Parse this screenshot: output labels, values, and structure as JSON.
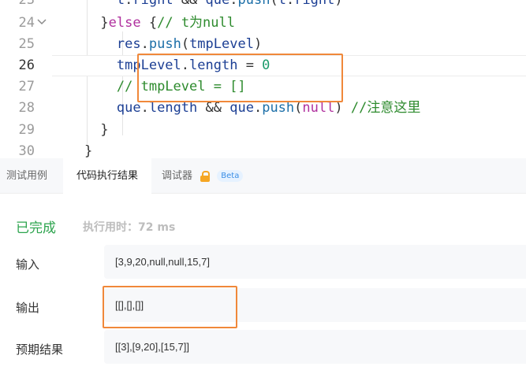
{
  "editor": {
    "lines": [
      {
        "num": "23",
        "tokens": [
          {
            "t": "        ",
            "c": ""
          },
          {
            "t": "t",
            "c": "id"
          },
          {
            "t": ".",
            "c": "op"
          },
          {
            "t": "right",
            "c": "id"
          },
          {
            "t": " && ",
            "c": "op"
          },
          {
            "t": "que",
            "c": "id"
          },
          {
            "t": ".",
            "c": "op"
          },
          {
            "t": "push",
            "c": "fn"
          },
          {
            "t": "(",
            "c": "op"
          },
          {
            "t": "t",
            "c": "id"
          },
          {
            "t": ".",
            "c": "op"
          },
          {
            "t": "right",
            "c": "id"
          },
          {
            "t": ")",
            "c": "op"
          }
        ]
      },
      {
        "num": "24",
        "fold": "chevron-down",
        "tokens": [
          {
            "t": "      ",
            "c": ""
          },
          {
            "t": "}",
            "c": "op"
          },
          {
            "t": "else",
            "c": "kw"
          },
          {
            "t": " {",
            "c": "op"
          },
          {
            "t": "// t为null",
            "c": "cm"
          }
        ]
      },
      {
        "num": "25",
        "tokens": [
          {
            "t": "        ",
            "c": ""
          },
          {
            "t": "res",
            "c": "id"
          },
          {
            "t": ".",
            "c": "op"
          },
          {
            "t": "push",
            "c": "fn"
          },
          {
            "t": "(",
            "c": "op"
          },
          {
            "t": "tmpLevel",
            "c": "id"
          },
          {
            "t": ")",
            "c": "op"
          }
        ]
      },
      {
        "num": "26",
        "active": true,
        "tokens": [
          {
            "t": "        ",
            "c": ""
          },
          {
            "t": "tmpLevel",
            "c": "id"
          },
          {
            "t": ".",
            "c": "op"
          },
          {
            "t": "length",
            "c": "id"
          },
          {
            "t": " = ",
            "c": "op"
          },
          {
            "t": "0",
            "c": "num"
          }
        ]
      },
      {
        "num": "27",
        "tokens": [
          {
            "t": "        ",
            "c": ""
          },
          {
            "t": "// tmpLevel = []",
            "c": "cm"
          }
        ]
      },
      {
        "num": "28",
        "tokens": [
          {
            "t": "        ",
            "c": ""
          },
          {
            "t": "que",
            "c": "id"
          },
          {
            "t": ".",
            "c": "op"
          },
          {
            "t": "length",
            "c": "id"
          },
          {
            "t": " && ",
            "c": "op"
          },
          {
            "t": "que",
            "c": "id"
          },
          {
            "t": ".",
            "c": "op"
          },
          {
            "t": "push",
            "c": "fn"
          },
          {
            "t": "(",
            "c": "op"
          },
          {
            "t": "null",
            "c": "kw"
          },
          {
            "t": ") ",
            "c": "op"
          },
          {
            "t": "//注意这里",
            "c": "cm"
          }
        ]
      },
      {
        "num": "29",
        "tokens": [
          {
            "t": "      ",
            "c": ""
          },
          {
            "t": "}",
            "c": "op"
          }
        ]
      },
      {
        "num": "30",
        "tokens": [
          {
            "t": "    ",
            "c": ""
          },
          {
            "t": "}",
            "c": "op"
          }
        ]
      }
    ]
  },
  "tabs": [
    {
      "label": "测试用例",
      "active": false
    },
    {
      "label": "代码执行结果",
      "active": true
    },
    {
      "label": "调试器",
      "active": false,
      "badge": "Beta",
      "icon": "lock-icon"
    }
  ],
  "result": {
    "status": "已完成",
    "runtime": "执行用时：72 ms",
    "fields": [
      {
        "label": "输入",
        "value": "[3,9,20,null,null,15,7]"
      },
      {
        "label": "输出",
        "value": "[[],[],[]]"
      },
      {
        "label": "预期结果",
        "value": "[[3],[9,20],[15,7]]"
      }
    ]
  },
  "colors": {
    "success": "#2da44e",
    "highlight_box": "#f0883a",
    "keyword": "#b0309e",
    "comment": "#2e8b2e",
    "number": "#1a9a6a",
    "identifier": "#1c3f94",
    "beta_badge": "#3a8ee6",
    "lock": "#f5a623"
  }
}
